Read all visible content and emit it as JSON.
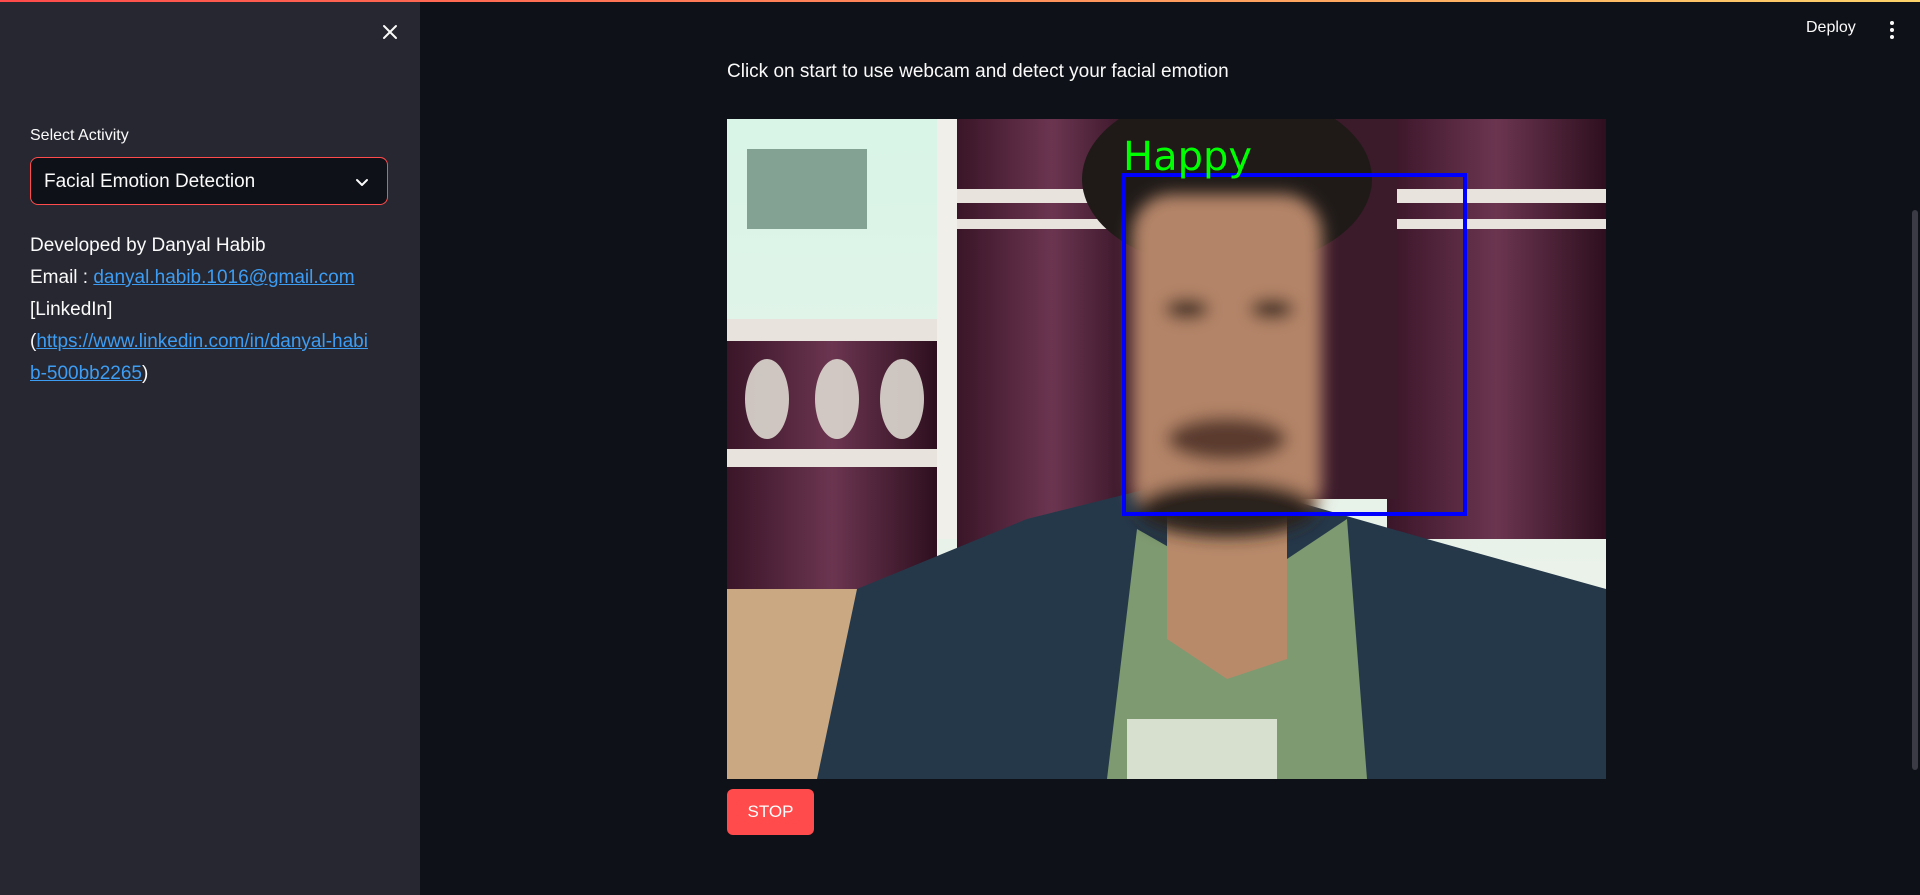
{
  "sidebar": {
    "select_label": "Select Activity",
    "select_value": "Facial Emotion Detection",
    "developed_by": "Developed by Danyal Habib",
    "email_prefix": "Email : ",
    "email": "danyal.habib.1016@gmail.com",
    "linkedin_label": "[LinkedIn]",
    "linkedin_open": "(",
    "linkedin_url": "https://www.linkedin.com/in/danyal-habib-500bb2265",
    "linkedin_close": ")"
  },
  "header": {
    "deploy_label": "Deploy"
  },
  "main": {
    "instruction": "Click on start to use webcam and detect your facial emotion",
    "emotion_label": "Happy",
    "stop_label": "STOP"
  },
  "colors": {
    "accent": "#ff4b4b",
    "link": "#3d9df3",
    "face_box": "#0000ff",
    "emotion_text": "#00ff00"
  },
  "icons": {
    "close": "close-icon",
    "chevron": "chevron-down-icon",
    "menu": "kebab-menu-icon"
  }
}
